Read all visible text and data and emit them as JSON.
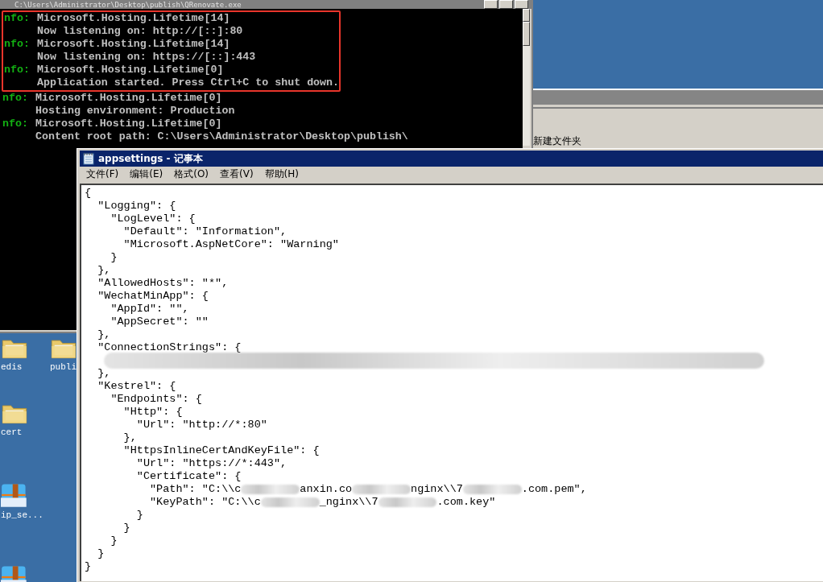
{
  "console": {
    "title": "C:\\Users\\Administrator\\Desktop\\publish\\QRenovate.exe",
    "lines": [
      {
        "level": "nfo:",
        "text": "Microsoft.Hosting.Lifetime[14]",
        "highlighted": true
      },
      {
        "text": "Now listening on: http://[::]:80",
        "highlighted": true
      },
      {
        "level": "nfo:",
        "text": "Microsoft.Hosting.Lifetime[14]",
        "highlighted": true
      },
      {
        "text": "Now listening on: https://[::]:443",
        "highlighted": true
      },
      {
        "level": "nfo:",
        "text": "Microsoft.Hosting.Lifetime[0]",
        "highlighted": true
      },
      {
        "text": "Application started. Press Ctrl+C to shut down.",
        "highlighted": true
      },
      {
        "level": "nfo:",
        "text": "Microsoft.Hosting.Lifetime[0]",
        "highlighted": false
      },
      {
        "text": "Hosting environment: Production",
        "highlighted": false
      },
      {
        "level": "nfo:",
        "text": "Microsoft.Hosting.Lifetime[0]",
        "highlighted": false
      },
      {
        "text": "Content root path: C:\\Users\\Administrator\\Desktop\\publish\\",
        "highlighted": false
      }
    ]
  },
  "explorer": {
    "item_label": "新建文件夹"
  },
  "desktop_icons": [
    {
      "label": "edis",
      "kind": "folder"
    },
    {
      "label": "publi",
      "kind": "folder"
    },
    {
      "label": "cert",
      "kind": "folder"
    },
    {
      "label": "ip_se...",
      "kind": "zip"
    },
    {
      "kind": "zip"
    }
  ],
  "notepad": {
    "title": "appsettings - 记事本",
    "menu": [
      "文件(F)",
      "编辑(E)",
      "格式(O)",
      "查看(V)",
      "帮助(H)"
    ],
    "lines": [
      {
        "parts": [
          {
            "kind": "text",
            "text": "{"
          }
        ]
      },
      {
        "parts": [
          {
            "kind": "text",
            "text": "  \"Logging\": {"
          }
        ]
      },
      {
        "parts": [
          {
            "kind": "text",
            "text": "    \"LogLevel\": {"
          }
        ]
      },
      {
        "parts": [
          {
            "kind": "text",
            "text": "      \"Default\": \"Information\","
          }
        ]
      },
      {
        "parts": [
          {
            "kind": "text",
            "text": "      \"Microsoft.AspNetCore\": \"Warning\""
          }
        ]
      },
      {
        "parts": [
          {
            "kind": "text",
            "text": "    }"
          }
        ]
      },
      {
        "parts": [
          {
            "kind": "text",
            "text": "  },"
          }
        ]
      },
      {
        "parts": [
          {
            "kind": "text",
            "text": "  \"AllowedHosts\": \"*\","
          }
        ]
      },
      {
        "parts": [
          {
            "kind": "text",
            "text": "  \"WechatMinApp\": {"
          }
        ]
      },
      {
        "parts": [
          {
            "kind": "text",
            "text": "    \"AppId\": \"\","
          }
        ]
      },
      {
        "parts": [
          {
            "kind": "text",
            "text": "    \"AppSecret\": \"\""
          }
        ]
      },
      {
        "parts": [
          {
            "kind": "text",
            "text": "  },"
          }
        ]
      },
      {
        "parts": [
          {
            "kind": "text",
            "text": "  \"ConnectionStrings\": {"
          }
        ]
      },
      {
        "parts": [
          {
            "kind": "redacted_line"
          }
        ]
      },
      {
        "parts": [
          {
            "kind": "text",
            "text": "  },"
          }
        ]
      },
      {
        "parts": [
          {
            "kind": "text",
            "text": "  \"Kestrel\": {"
          }
        ]
      },
      {
        "parts": [
          {
            "kind": "text",
            "text": "    \"Endpoints\": {"
          }
        ]
      },
      {
        "parts": [
          {
            "kind": "text",
            "text": "      \"Http\": {"
          }
        ]
      },
      {
        "parts": [
          {
            "kind": "text",
            "text": "        \"Url\": \"http://*:80\""
          }
        ]
      },
      {
        "parts": [
          {
            "kind": "text",
            "text": "      },"
          }
        ]
      },
      {
        "parts": [
          {
            "kind": "text",
            "text": "      \"HttpsInlineCertAndKeyFile\": {"
          }
        ]
      },
      {
        "parts": [
          {
            "kind": "text",
            "text": "        \"Url\": \"https://*:443\","
          }
        ]
      },
      {
        "parts": [
          {
            "kind": "text",
            "text": "        \"Certificate\": {"
          }
        ]
      },
      {
        "parts": [
          {
            "kind": "text",
            "text": "          \"Path\": \"C:\\\\c"
          },
          {
            "kind": "redacted"
          },
          {
            "kind": "text",
            "text": "anxin.co"
          },
          {
            "kind": "redacted"
          },
          {
            "kind": "text",
            "text": "nginx\\\\7"
          },
          {
            "kind": "redacted"
          },
          {
            "kind": "text",
            "text": ".com.pem\","
          }
        ]
      },
      {
        "parts": [
          {
            "kind": "text",
            "text": "          \"KeyPath\": \"C:\\\\c"
          },
          {
            "kind": "redacted"
          },
          {
            "kind": "text",
            "text": "_nginx\\\\7"
          },
          {
            "kind": "redacted"
          },
          {
            "kind": "text",
            "text": ".com.key\""
          }
        ]
      },
      {
        "parts": [
          {
            "kind": "text",
            "text": "        }"
          }
        ]
      },
      {
        "parts": [
          {
            "kind": "text",
            "text": "      }"
          }
        ]
      },
      {
        "parts": [
          {
            "kind": "text",
            "text": "    }"
          }
        ]
      },
      {
        "parts": [
          {
            "kind": "text",
            "text": "  }"
          }
        ]
      },
      {
        "parts": [
          {
            "kind": "text",
            "text": "}"
          }
        ]
      }
    ]
  }
}
